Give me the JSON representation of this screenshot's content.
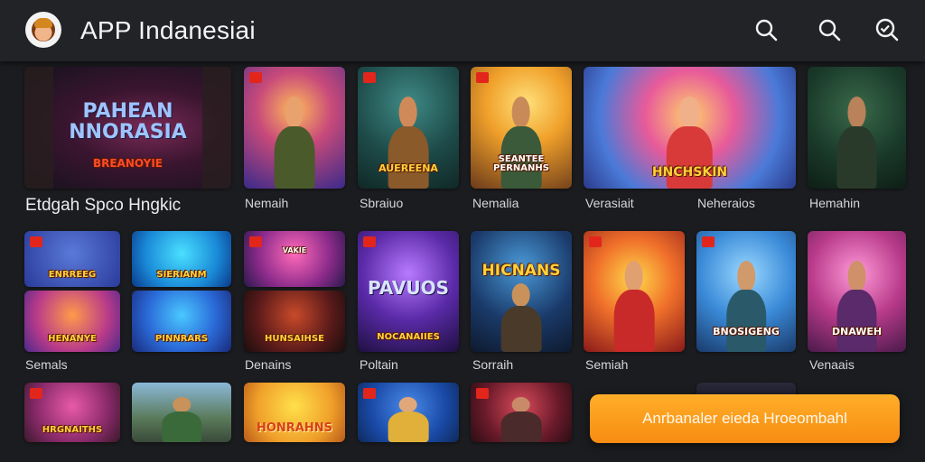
{
  "header": {
    "title": "APP Indanesiai",
    "icons": [
      "search-icon",
      "search-icon",
      "search-zoom-icon"
    ]
  },
  "featured": {
    "logo": "PAHEAN NNORASIA",
    "sublogo": "BREANOYIE",
    "caption": "Etdgah Spco Hngkic"
  },
  "row1": [
    {
      "caption": "Nemaih",
      "logo": ""
    },
    {
      "caption": "Sbraiuo",
      "logo": "AUEREENA"
    },
    {
      "caption": "Nemalia",
      "logo": "SEANTEE PERNANHS"
    },
    {
      "caption": "Verasiait",
      "logo": "HNCHSKIN"
    },
    {
      "caption": "Neheraios",
      "logo": ""
    },
    {
      "caption": "Hemahin",
      "logo": ""
    }
  ],
  "row2_captions": [
    "Semals",
    "Denains",
    "Poltain",
    "Sorraih",
    "Semiah",
    "Venaais"
  ],
  "row2_logos": {
    "a": "ENRREEG",
    "b": "SIERIANM",
    "c": "HENANYE",
    "d": "PINNRARS",
    "e": "VAKIE",
    "f": "HUNSAIHSE",
    "g": "PAVUOS",
    "h": "NOCANAIIES",
    "i": "HICNANS",
    "j": "BNOSIGENG",
    "k": "DNAWEH"
  },
  "row3_logos": {
    "a": "HRGNAITHS",
    "b": "HONRAHNS"
  },
  "cta": {
    "label": "Anrbanaler eieda Hroeombahl"
  },
  "colors": {
    "accent": "#f7941d",
    "topbar": "#222326",
    "background": "#1b1c1f"
  }
}
